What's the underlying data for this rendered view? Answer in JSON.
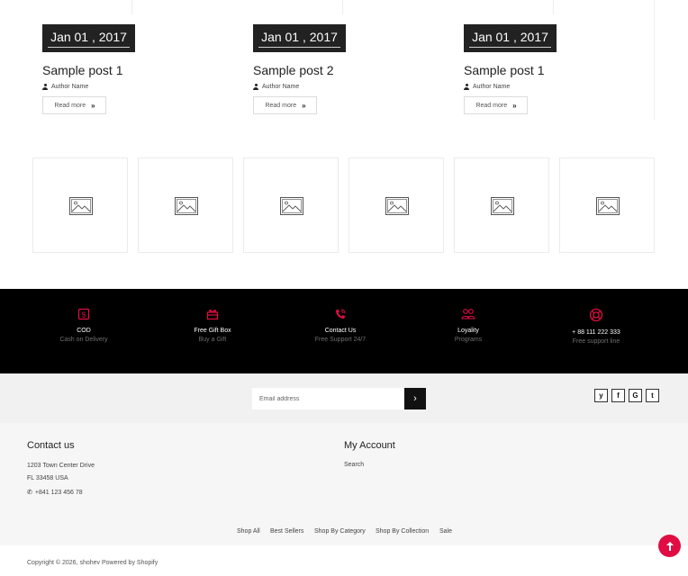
{
  "blog": {
    "posts": [
      {
        "date": "Jan 01 , 2017",
        "title": "Sample post 1",
        "author": "Author Name",
        "read_more": "Read more"
      },
      {
        "date": "Jan 01 , 2017",
        "title": "Sample post 2",
        "author": "Author Name",
        "read_more": "Read more"
      },
      {
        "date": "Jan 01 , 2017",
        "title": "Sample post 1",
        "author": "Author Name",
        "read_more": "Read more"
      }
    ]
  },
  "brands": {
    "count": 6,
    "icon": "image-placeholder-icon"
  },
  "services": [
    {
      "icon": "cash-icon",
      "title": "COD",
      "subtitle": "Cash on Delivery"
    },
    {
      "icon": "gift-box-icon",
      "title": "Free Gift Box",
      "subtitle": "Buy a Gift"
    },
    {
      "icon": "phone-call-icon",
      "title": "Contact Us",
      "subtitle": "Free Support 24/7"
    },
    {
      "icon": "users-icon",
      "title": "Loyality",
      "subtitle": "Programs"
    },
    {
      "icon": "lifebuoy-icon",
      "title": "+ 88 111 222 333",
      "subtitle": "Free support line"
    }
  ],
  "newsletter": {
    "placeholder": "Email address",
    "submit_label": "›"
  },
  "social": [
    {
      "icon": "twitter-icon",
      "glyph": "y"
    },
    {
      "icon": "facebook-icon",
      "glyph": "f"
    },
    {
      "icon": "google-icon",
      "glyph": "G"
    },
    {
      "icon": "tumblr-icon",
      "glyph": "t"
    }
  ],
  "footer": {
    "contact": {
      "heading": "Contact us",
      "address_line1": "1203 Town Center Drive",
      "address_line2": "FL 33458 USA",
      "phone": "+841 123 456 78"
    },
    "account": {
      "heading": "My Account",
      "links": [
        "Search"
      ]
    },
    "nav": [
      "Shop All",
      "Best Sellers",
      "Shop By Category",
      "Shop By Collection",
      "Sale"
    ],
    "copyright": "Copyright © 2026, shohev Powered by Shopify"
  },
  "colors": {
    "accent": "#e10c43",
    "dark": "#222222",
    "service_bar": "#000000"
  }
}
